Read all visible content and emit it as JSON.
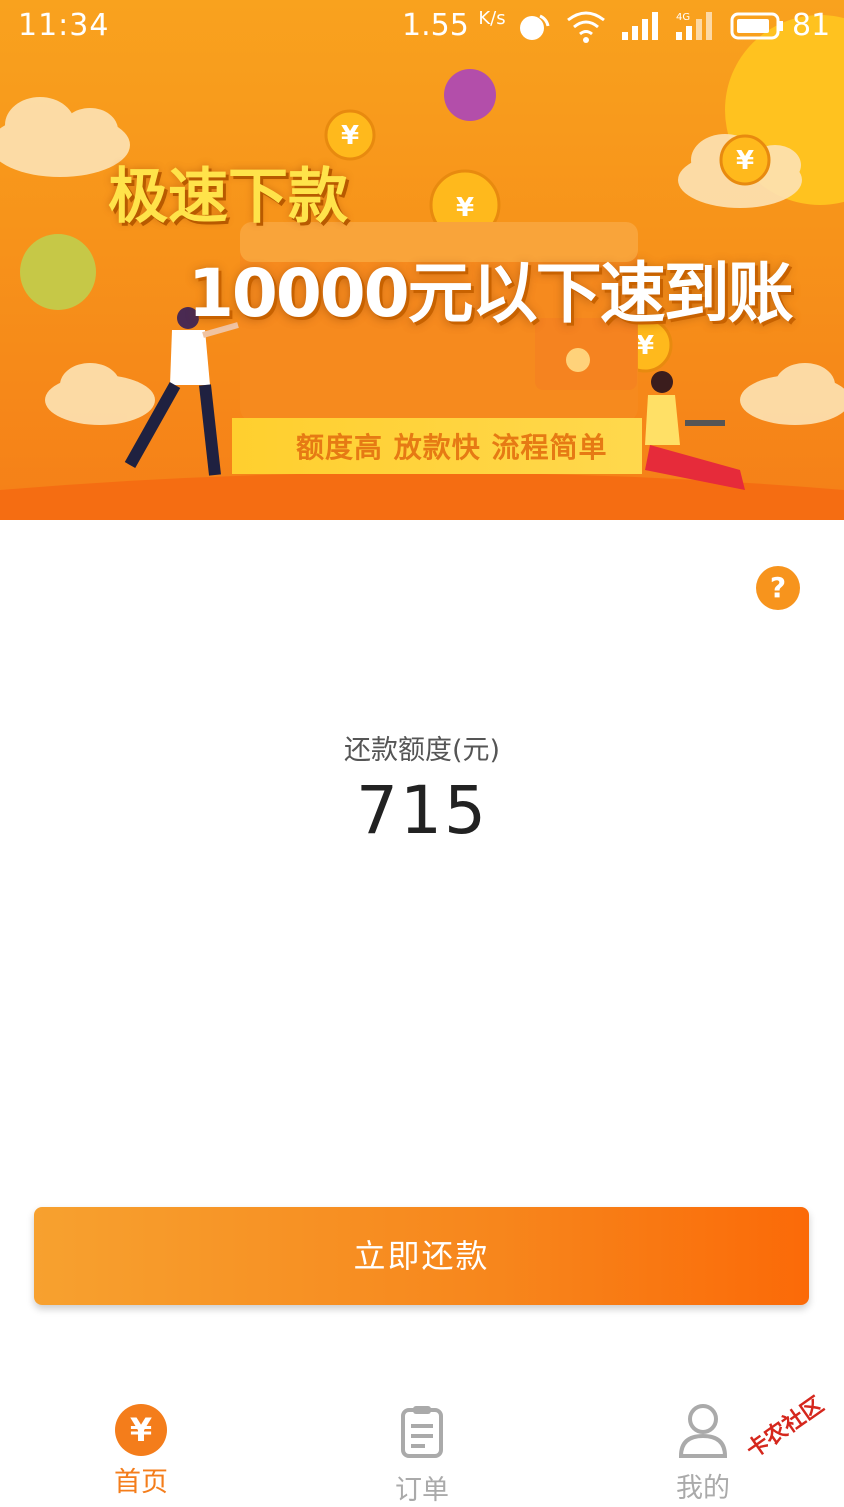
{
  "status_bar": {
    "time": "11:34",
    "speed_value": "1.55",
    "speed_unit": "K/s",
    "battery": "81"
  },
  "banner": {
    "title": "极速下款",
    "subtitle": "10000元以下速到账",
    "tagline": "额度高 放款快 流程简单"
  },
  "help": {
    "icon": "question-icon",
    "glyph": "?"
  },
  "repayment": {
    "label": "还款额度(元)",
    "amount": "715"
  },
  "action": {
    "button_label": "立即还款"
  },
  "tabs": [
    {
      "label": "首页",
      "icon": "yuan-icon",
      "glyph": "¥",
      "active": true
    },
    {
      "label": "订单",
      "icon": "clipboard-icon",
      "active": false
    },
    {
      "label": "我的",
      "icon": "user-icon",
      "active": false
    }
  ],
  "watermark": "卡农社区",
  "colors": {
    "accent": "#f47d1b",
    "button_start": "#f7a12f",
    "button_end": "#fb6a08",
    "inactive": "#aaaaaa"
  }
}
